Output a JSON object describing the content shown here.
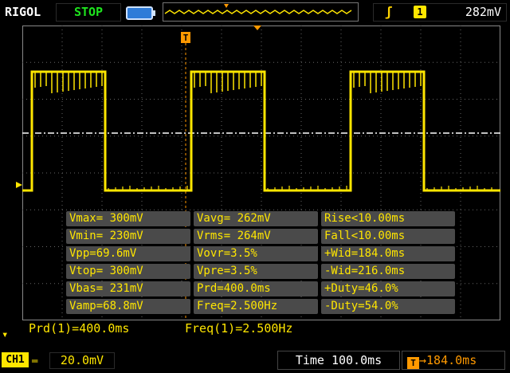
{
  "header": {
    "brand": "RIGOL",
    "status": "STOP",
    "trigger_channel": "1",
    "trigger_level": "282mV"
  },
  "measurements": [
    [
      "Vmax= 300mV",
      "Vavg= 262mV",
      "Rise<10.00ms"
    ],
    [
      "Vmin= 230mV",
      "Vrms= 264mV",
      "Fall<10.00ms"
    ],
    [
      "Vpp=69.6mV",
      "Vovr=3.5%",
      "+Wid=184.0ms"
    ],
    [
      "Vtop= 300mV",
      "Vpre=3.5%",
      "-Wid=216.0ms"
    ],
    [
      "Vbas= 231mV",
      "Prd=400.0ms",
      "+Duty=46.0%"
    ],
    [
      "Vamp=68.8mV",
      "Freq=2.500Hz",
      "-Duty=54.0%"
    ]
  ],
  "quick_measure": {
    "period": "Prd(1)=400.0ms",
    "frequency": "Freq(1)=2.500Hz"
  },
  "footer": {
    "channel": "CH1",
    "volts_div": "20.0mV",
    "time_label": "Time",
    "time_div": "100.0ms",
    "trigger_offset": "184.0ms",
    "trigger_icon_letter": "T"
  },
  "waveform": {
    "high_level": 300,
    "low_level": 230,
    "period_ms": 400,
    "high_width_ms": 184,
    "time_div_ms": 100,
    "color": "#ffe600"
  },
  "colors": {
    "trace": "#ffe600",
    "trigger": "#ff9900",
    "status": "#1ee31e"
  }
}
